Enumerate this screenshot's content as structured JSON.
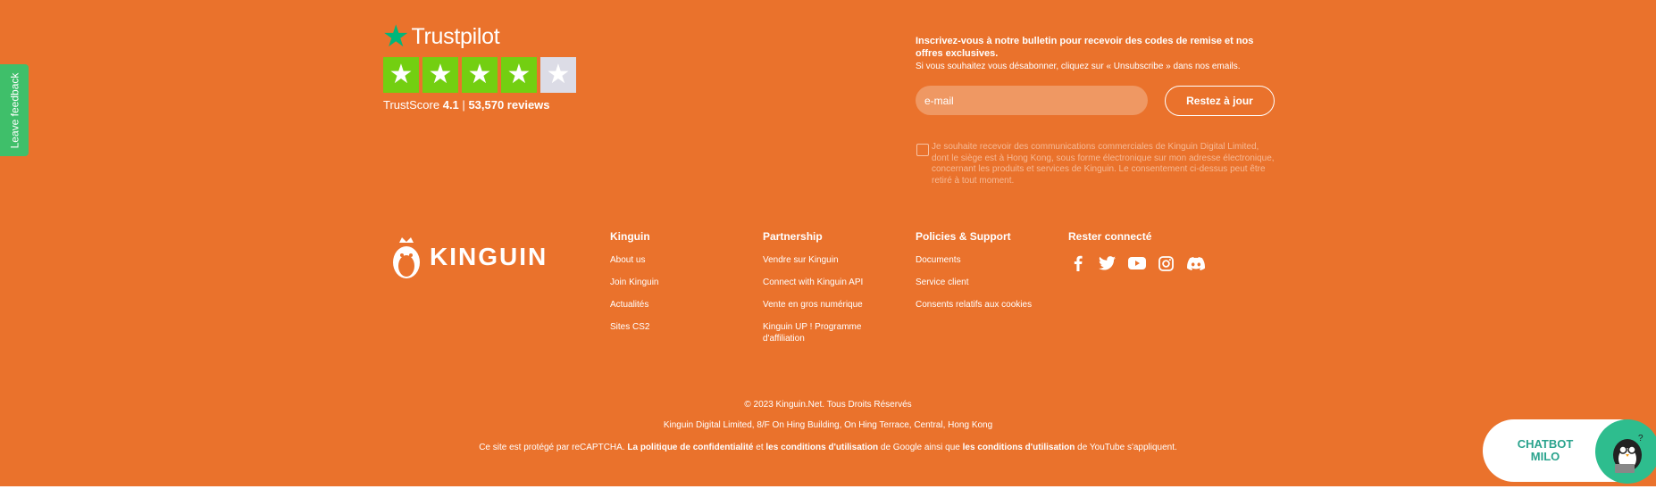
{
  "feedback": {
    "label": "Leave feedback"
  },
  "trustpilot": {
    "brand": "Trustpilot",
    "stars_filled": 4,
    "stars_total": 5,
    "score_label": "TrustScore",
    "score": "4.1",
    "separator": "|",
    "reviews": "53,570 reviews",
    "star_color": "#00b67a",
    "box_color": "#73cf11"
  },
  "newsletter": {
    "title": "Inscrivez-vous à notre bulletin pour recevoir des codes de remise et nos offres exclusives.",
    "subtitle": "Si vous souhaitez vous désabonner, cliquez sur « Unsubscribe » dans nos emails.",
    "email_placeholder": "e-mail",
    "button": "Restez à jour",
    "consent": "Je souhaite recevoir des communications commerciales de Kinguin Digital Limited, dont le siège est à Hong Kong, sous forme électronique sur mon adresse électronique, concernant les produits et services de Kinguin. Le consentement ci-dessus peut être retiré à tout moment."
  },
  "brand": {
    "name": "KINGUIN"
  },
  "columns": [
    {
      "title": "Kinguin",
      "links": [
        "About us",
        "Join Kinguin",
        "Actualités",
        "Sites CS2"
      ]
    },
    {
      "title": "Partnership",
      "links": [
        "Vendre sur Kinguin",
        "Connect with Kinguin API",
        "Vente en gros numérique",
        "Kinguin UP ! Programme d'affiliation"
      ]
    },
    {
      "title": "Policies & Support",
      "links": [
        "Documents",
        "Service client",
        "Consents relatifs aux cookies"
      ]
    },
    {
      "title": "Rester connecté",
      "social": [
        "facebook-icon",
        "twitter-icon",
        "youtube-icon",
        "instagram-icon",
        "discord-icon"
      ]
    }
  ],
  "bottom": {
    "copyright": "© 2023 Kinguin.Net. Tous Droits Réservés",
    "address": "Kinguin Digital Limited, 8/F On Hing Building, On Hing Terrace, Central, Hong Kong",
    "recaptcha_prefix": "Ce site est protégé par reCAPTCHA.",
    "privacy_link": "La politique de confidentialité",
    "and": "et",
    "terms_link": "les conditions d'utilisation",
    "google_mid": "de Google ainsi que",
    "terms_link_2": "les conditions d'utilisation",
    "youtube_suffix": "de YouTube s'appliquent."
  },
  "chatbot": {
    "line1": "CHATBOT",
    "line2": "MILO"
  },
  "colors": {
    "footer_bg": "#ea722c",
    "feedback_bg": "#3fbf6a",
    "chatbot_text": "#2aa38d"
  }
}
